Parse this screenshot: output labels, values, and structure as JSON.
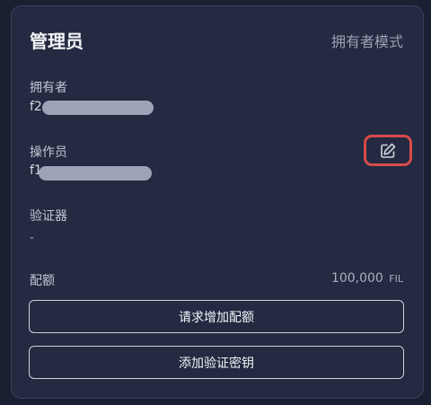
{
  "header": {
    "title": "管理员",
    "mode": "拥有者模式"
  },
  "owner": {
    "label": "拥有者",
    "value_prefix": "f2"
  },
  "operator": {
    "label": "操作员",
    "value_prefix": "f1",
    "edit_icon": "edit-icon"
  },
  "verifier": {
    "label": "验证器",
    "value": "-"
  },
  "quota": {
    "label": "配额",
    "amount": "100,000",
    "unit": "FIL"
  },
  "actions": {
    "request_quota": "请求增加配额",
    "add_verifier_key": "添加验证密钥"
  },
  "colors": {
    "background": "#1a1f31",
    "card": "#232a41",
    "highlight": "#d84a4a"
  }
}
